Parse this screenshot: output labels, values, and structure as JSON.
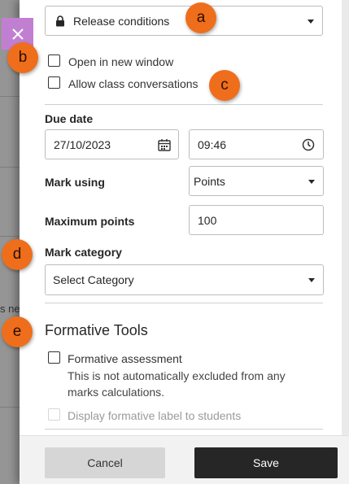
{
  "background": {
    "partial_text": "s ne"
  },
  "close_button": {
    "icon": "close-icon"
  },
  "release_conditions": {
    "label": "Release conditions",
    "icon": "lock-icon"
  },
  "options": {
    "open_new_window": "Open in new window",
    "class_conversations": "Allow class conversations"
  },
  "due_date": {
    "label": "Due date",
    "date_value": "27/10/2023",
    "time_value": "09:46"
  },
  "mark_using": {
    "label": "Mark using",
    "value": "Points"
  },
  "maximum_points": {
    "label": "Maximum points",
    "value": "100"
  },
  "mark_category": {
    "label": "Mark category",
    "value": "Select Category"
  },
  "formative_tools": {
    "title": "Formative Tools",
    "assessment_label": "Formative assessment",
    "helper_line1": "This is not automatically excluded from any",
    "helper_line2": "marks calculations.",
    "display_label": "Display formative label to students"
  },
  "footer": {
    "cancel": "Cancel",
    "save": "Save"
  },
  "markers": [
    "a",
    "b",
    "c",
    "d",
    "e"
  ],
  "colors": {
    "marker": "#ef6e1b",
    "close": "#c17fd2",
    "save_bg": "#262626"
  }
}
